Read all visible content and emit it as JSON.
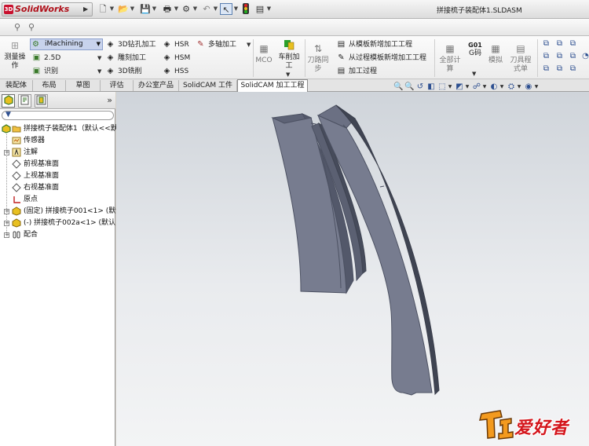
{
  "app": {
    "brand": "SolidWorks",
    "window_title": "拼接梳子装配体1.SLDASM"
  },
  "ribbon": {
    "measure": "测量操作",
    "imachining": "iMachining",
    "mill_25d": "2.5D",
    "recognize": "识别",
    "drill_3d": "3D钻孔加工",
    "engrave": "雕刻加工",
    "mill_3d": "3D铣削",
    "hsr": "HSR",
    "hsm": "HSM",
    "hss": "HSS",
    "multiaxis": "多轴加工",
    "mco": "MCO",
    "turning": "车削加工",
    "tool_sync": "刀路同步",
    "new_from_template": "从模板新增加工工程",
    "new_from_process_template": "从过程模板新增加工工程",
    "process": "加工过程",
    "calc_all": "全部计算",
    "gcode_title": "G01",
    "gcode": "G码",
    "simulate": "模拟",
    "tool_table": "刀具程式单"
  },
  "tabs": [
    "装配体",
    "布局",
    "草图",
    "评估",
    "办公室产品",
    "SolidCAM 工件",
    "SolidCAM 加工工程"
  ],
  "tree": {
    "root": "拼接梳子装配体1（默认<<默",
    "sensors": "传感器",
    "annotations": "注解",
    "front_plane": "前视基准面",
    "top_plane": "上视基准面",
    "right_plane": "右视基准面",
    "origin": "原点",
    "part1": "(固定) 拼接梳子001<1> (默认",
    "part2": "(-) 拼接梳子002a<1> (默认",
    "mates": "配合"
  },
  "colors": {
    "part_face": "#777c8f",
    "part_edge": "#4d5263",
    "ribbon_highlight": "#c8d3ec",
    "watermark_orange": "#f39a1e",
    "watermark_red": "#d4151b"
  },
  "watermark": {
    "text": "爱好者"
  }
}
